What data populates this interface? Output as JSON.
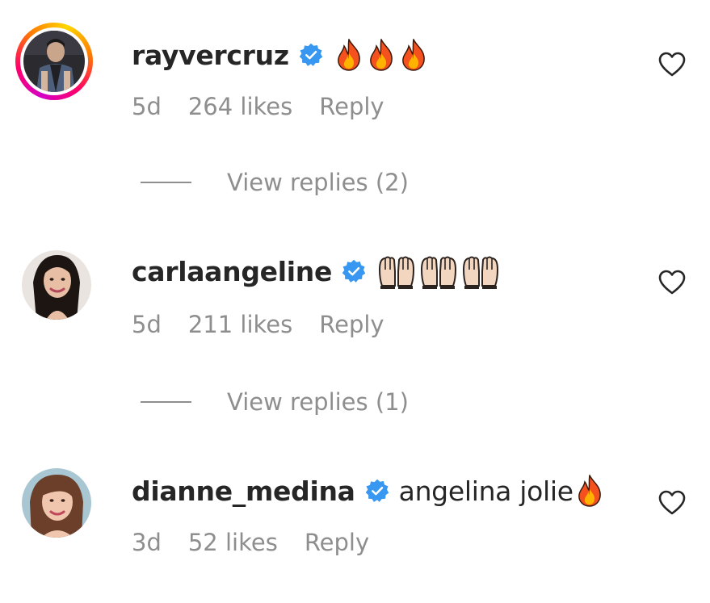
{
  "comments": [
    {
      "username": "rayvercruz",
      "verified": true,
      "text": "",
      "emojis": [
        "fire",
        "fire",
        "fire"
      ],
      "time": "5d",
      "likes": "264 likes",
      "reply_label": "Reply",
      "view_replies": "View replies (2)",
      "story_ring": true
    },
    {
      "username": "carlaangeline",
      "verified": true,
      "text": "",
      "emojis": [
        "raising-hands",
        "raising-hands",
        "raising-hands"
      ],
      "time": "5d",
      "likes": "211 likes",
      "reply_label": "Reply",
      "view_replies": "View replies (1)",
      "story_ring": false
    },
    {
      "username": "dianne_medina",
      "verified": true,
      "text": "angelina jolie",
      "emojis": [
        "fire"
      ],
      "time": "3d",
      "likes": "52 likes",
      "reply_label": "Reply",
      "view_replies": "",
      "story_ring": false
    }
  ],
  "colors": {
    "text_primary": "#262626",
    "text_secondary": "#8e8e8e",
    "verified_blue": "#3897f0"
  }
}
